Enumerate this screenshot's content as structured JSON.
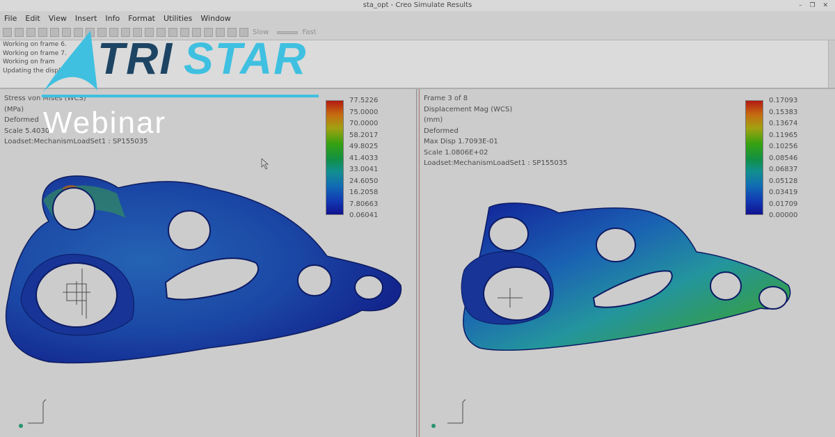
{
  "window": {
    "title": "sta_opt - Creo Simulate Results",
    "controls": "– ❐ ✕"
  },
  "menubar": {
    "items": [
      "File",
      "Edit",
      "View",
      "Insert",
      "Info",
      "Format",
      "Utilities",
      "Window"
    ]
  },
  "toolbar": {
    "slow_label": "Slow",
    "fast_label": "Fast"
  },
  "log": {
    "lines": [
      "Working on frame 6.",
      "Working on frame 7.",
      "Working on fram",
      "Updating the display ..."
    ]
  },
  "left_panel": {
    "info_lines": [
      "Stress von Mises (WCS)",
      "(MPa)",
      "Deformed",
      "Scale  5.4030",
      "Loadset:MechanismLoadSet1 :  SP155035"
    ],
    "legend_values": [
      "77.5226",
      "75.0000",
      "70.0000",
      "58.2017",
      "49.8025",
      "41.4033",
      "33.0041",
      "24.6050",
      "16.2058",
      "7.80663",
      "0.06041"
    ]
  },
  "right_panel": {
    "info_lines": [
      "Frame 3 of 8",
      "Displacement Mag (WCS)",
      "(mm)",
      "Deformed",
      "Max Disp  1.7093E-01",
      "Scale  1.0806E+02",
      "Loadset:MechanismLoadSet1 :  SP155035"
    ],
    "legend_values": [
      "0.17093",
      "0.15383",
      "0.13674",
      "0.11965",
      "0.10256",
      "0.08546",
      "0.06837",
      "0.05128",
      "0.03419",
      "0.01709",
      "0.00000"
    ]
  },
  "brand": {
    "logo_part1": "TRI",
    "logo_part2": "STAR",
    "subtitle": "Webinar"
  },
  "colors": {
    "brand_dark": "#1d4463",
    "brand_cyan": "#3fc0e0"
  }
}
